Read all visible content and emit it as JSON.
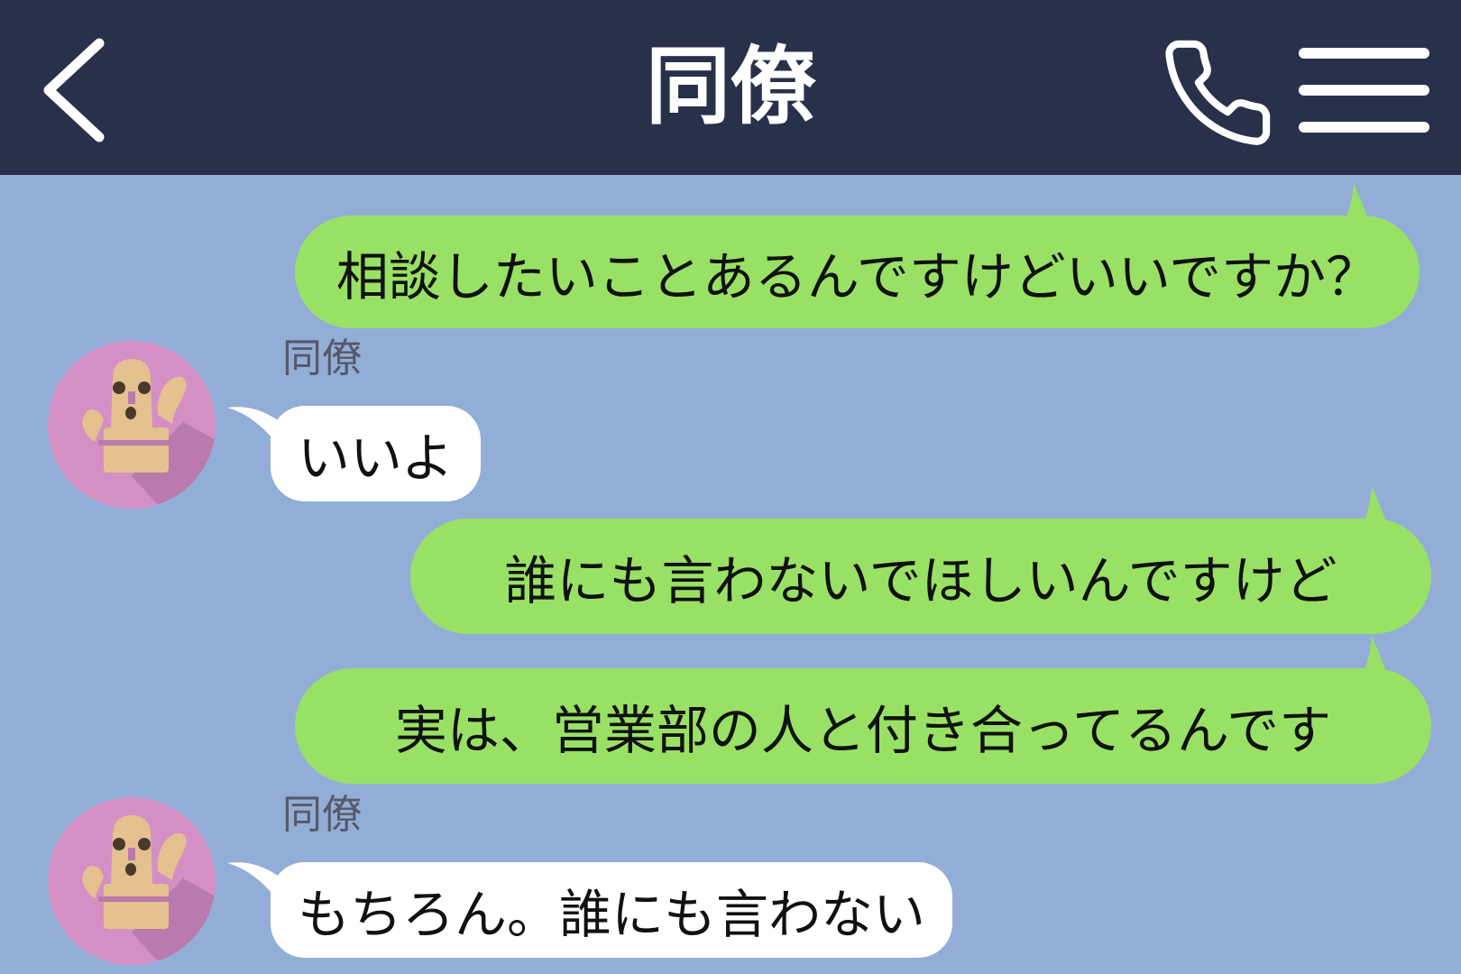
{
  "colors": {
    "header_bg": "#283149",
    "chat_bg": "#93aed6",
    "outgoing_bubble": "#98e165",
    "incoming_bubble": "#ffffff",
    "sender_name": "#55596a",
    "avatar_bg": "#d48fc5",
    "avatar_shadow": "#b97aad",
    "avatar_figure": "#e4c18f"
  },
  "header": {
    "title": "同僚",
    "back_icon": "chevron-left-icon",
    "call_icon": "phone-icon",
    "menu_icon": "hamburger-menu-icon"
  },
  "messages": [
    {
      "direction": "outgoing",
      "text": "相談したいことあるんですけどいいですか？"
    },
    {
      "direction": "incoming",
      "sender": "同僚",
      "text": "いいよ"
    },
    {
      "direction": "outgoing",
      "text": "誰にも言わないでほしいんですけど"
    },
    {
      "direction": "outgoing",
      "text": "実は、営業部の人と付き合ってるんです"
    },
    {
      "direction": "incoming",
      "sender": "同僚",
      "text": "もちろん。誰にも言わない"
    }
  ]
}
